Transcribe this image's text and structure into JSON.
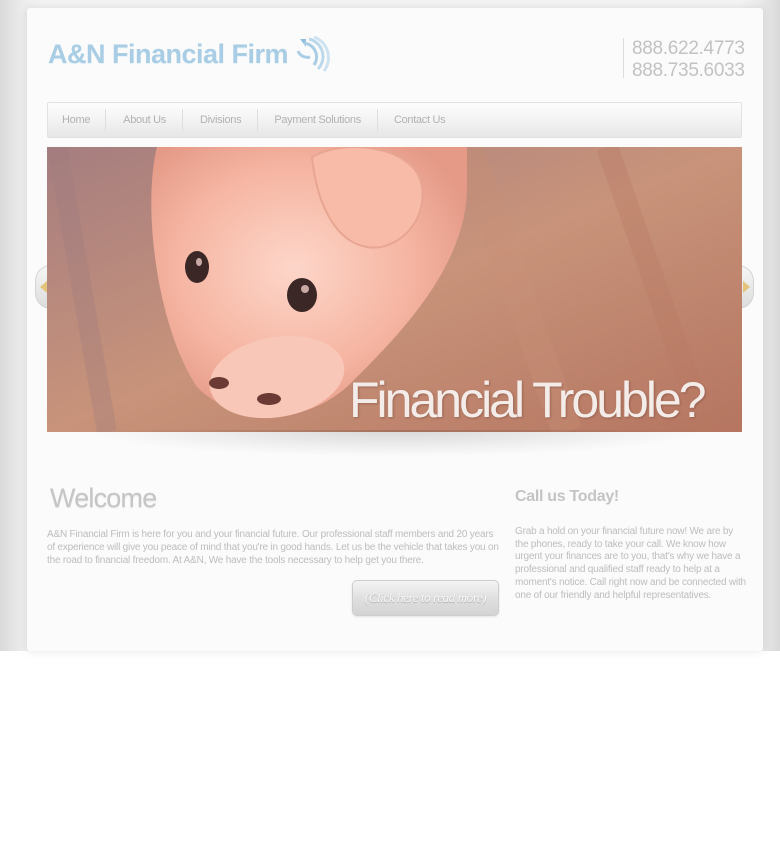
{
  "header": {
    "logo_text": "A&N Financial Firm",
    "phones": [
      "888.622.4773",
      "888.735.6033"
    ]
  },
  "nav": {
    "items": [
      {
        "label": "Home"
      },
      {
        "label": "About Us"
      },
      {
        "label": "Divisions"
      },
      {
        "label": "Payment Solutions"
      },
      {
        "label": "Contact Us"
      }
    ]
  },
  "slider": {
    "caption": "Financial Trouble?",
    "image": "piggy-bank-photo"
  },
  "welcome": {
    "title": "Welcome",
    "text": "A&N Financial Firm is here for you and your financial future. Our professional staff members and 20 years of experience will give you peace of mind that you're in good hands. Let us be the vehicle that takes you on the road to financial freedom. At A&N, We have the tools necessary to help get you there.",
    "read_more_label": "(Click here to read more)"
  },
  "call": {
    "title": "Call us Today!",
    "text": "Grab a hold on your financial future now! We are by the phones, ready to take your call. We know how urgent your finances are to you, that's why we have a professional and qualified staff ready to help at a moment's notice. Call right now and be connected with one of our friendly and helpful representatives."
  },
  "colors": {
    "logo": "#a9cde5",
    "text": "#bdbdbd",
    "slider_warm": "#c8846a"
  }
}
